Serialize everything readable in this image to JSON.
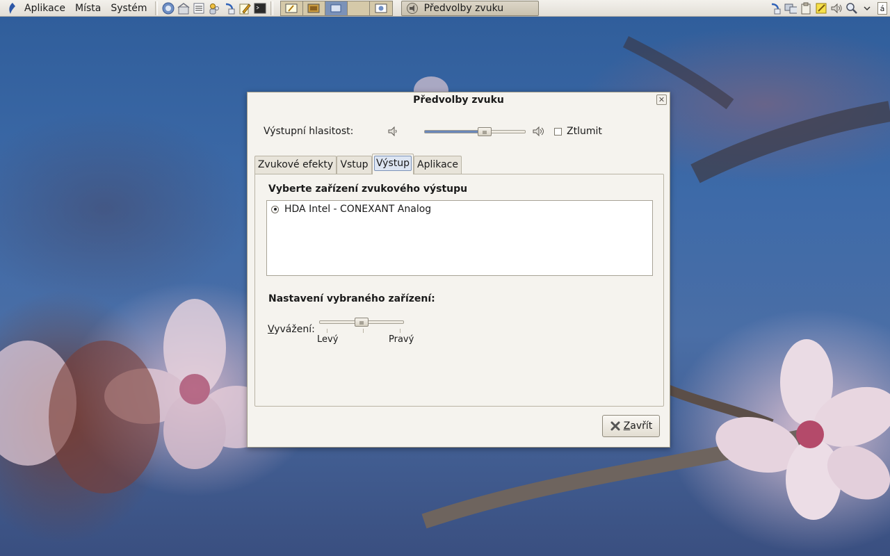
{
  "top_panel": {
    "menus": [
      "Aplikace",
      "Místa",
      "Systém"
    ],
    "launchers": [
      "web-browser-icon",
      "home-folder-icon",
      "terminal-list-icon",
      "users-icon",
      "update-icon",
      "text-editor-icon",
      "terminal-icon"
    ],
    "workspaces": 4,
    "active_workspace": 3,
    "taskbar_title": "Předvolby zvuku",
    "tray_icons": [
      "update-icon",
      "network-icon",
      "clipboard-icon",
      "notes-icon",
      "volume-icon",
      "search-icon",
      "chevron-down-icon",
      "keyboard-icon"
    ],
    "keyboard_layout": "á"
  },
  "dialog": {
    "title": "Předvolby zvuku",
    "volume_label": "Výstupní hlasitost:",
    "volume_level": 0.6,
    "mute_label": "Ztlumit",
    "mute_checked": false,
    "tabs": [
      "Zvukové efekty",
      "Vstup",
      "Výstup",
      "Aplikace"
    ],
    "active_tab": "Výstup",
    "device_heading": "Vyberte zařízení zvukového výstupu",
    "devices": [
      "HDA Intel - CONEXANT Analog"
    ],
    "selected_device": 0,
    "settings_heading": "Nastavení vybraného zařízení:",
    "balance_label": "Vyvážení:",
    "balance_level": 0.5,
    "balance_left": "Levý",
    "balance_right": "Pravý",
    "close_button": "Zavřít"
  }
}
